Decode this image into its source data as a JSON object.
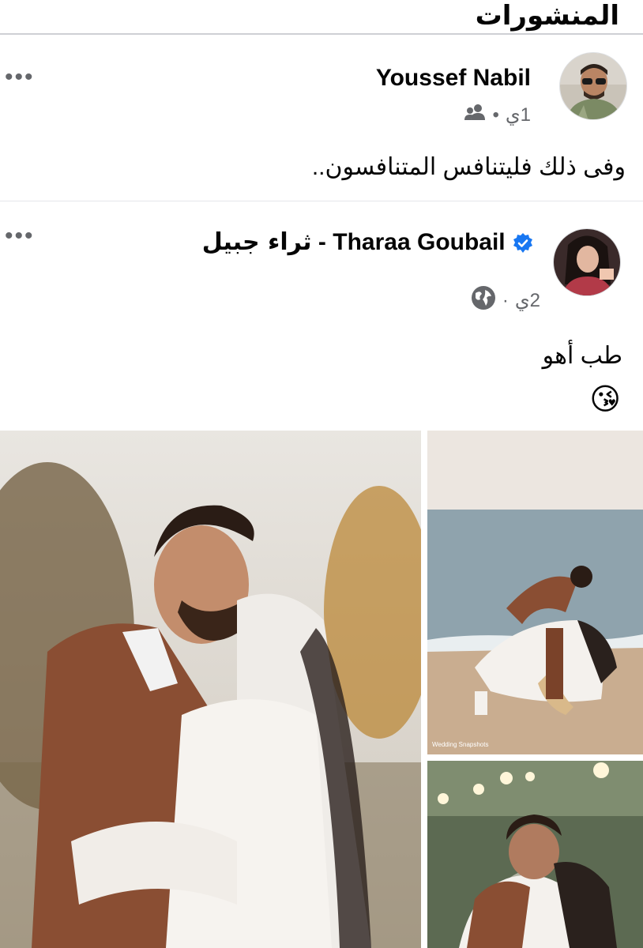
{
  "section": {
    "title": "المنشورات"
  },
  "posts": [
    {
      "author": "Youssef Nabil",
      "time": "1ي",
      "separator": "•",
      "audience_icon": "friends-icon",
      "text": "وفى ذلك فليتنافس المتنافسون..",
      "more_label": "•••"
    },
    {
      "author_latin": "Tharaa Goubail",
      "author_arabic": "ثراء جبيل",
      "author_sep": "-",
      "verified": true,
      "time": "2ي",
      "separator": "·",
      "audience_icon": "globe-icon",
      "text": "طب أهو",
      "emoji": "😘",
      "more_label": "•••",
      "photo_watermark": "Wedding Snapshots"
    }
  ],
  "colors": {
    "verified_blue": "#1877f2",
    "secondary_text": "#65676b",
    "divider": "#ced0d4"
  }
}
